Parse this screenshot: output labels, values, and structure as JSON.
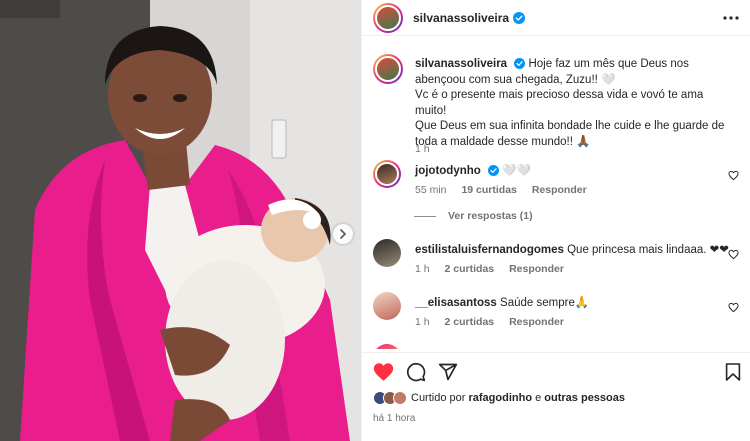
{
  "post": {
    "author": "silvanassoliveira",
    "time": "há 1 hora",
    "liked_prefix": "Curtido por",
    "liked_user": "rafagodinho",
    "liked_joiner": "e",
    "liked_others": "outras pessoas"
  },
  "caption": {
    "username": "silvanassoliveira",
    "text": "Hoje faz um mês que Deus nos abençoou com sua chegada, Zuzu!! 🤍\nVc é o presente mais precioso dessa vida e vovó te ama muito!\nQue Deus em sua infinita bondade lhe cuide e lhe guarde de toda a maldade desse mundo!! 🙏🏾",
    "time": "1 h"
  },
  "comments": [
    {
      "username": "jojotodynho",
      "text": "🤍🤍",
      "time": "55 min",
      "likes": "19 curtidas",
      "reply": "Responder",
      "verified": true
    },
    {
      "username": "estilistaluisfernandogomes",
      "text": "Que princesa mais lindaaa. ❤❤",
      "time": "1 h",
      "likes": "2 curtidas",
      "reply": "Responder"
    },
    {
      "username": "__elisasantoss",
      "text": "Saúde sempre🙏",
      "time": "1 h",
      "likes": "2 curtidas",
      "reply": "Responder"
    }
  ],
  "view_replies": "Ver respostas (1)",
  "colors": {
    "accent_pink": "#ee2a7b",
    "like_red": "#ff3040",
    "verified_blue": "#0095f6",
    "jacket": "#e91e8c"
  }
}
